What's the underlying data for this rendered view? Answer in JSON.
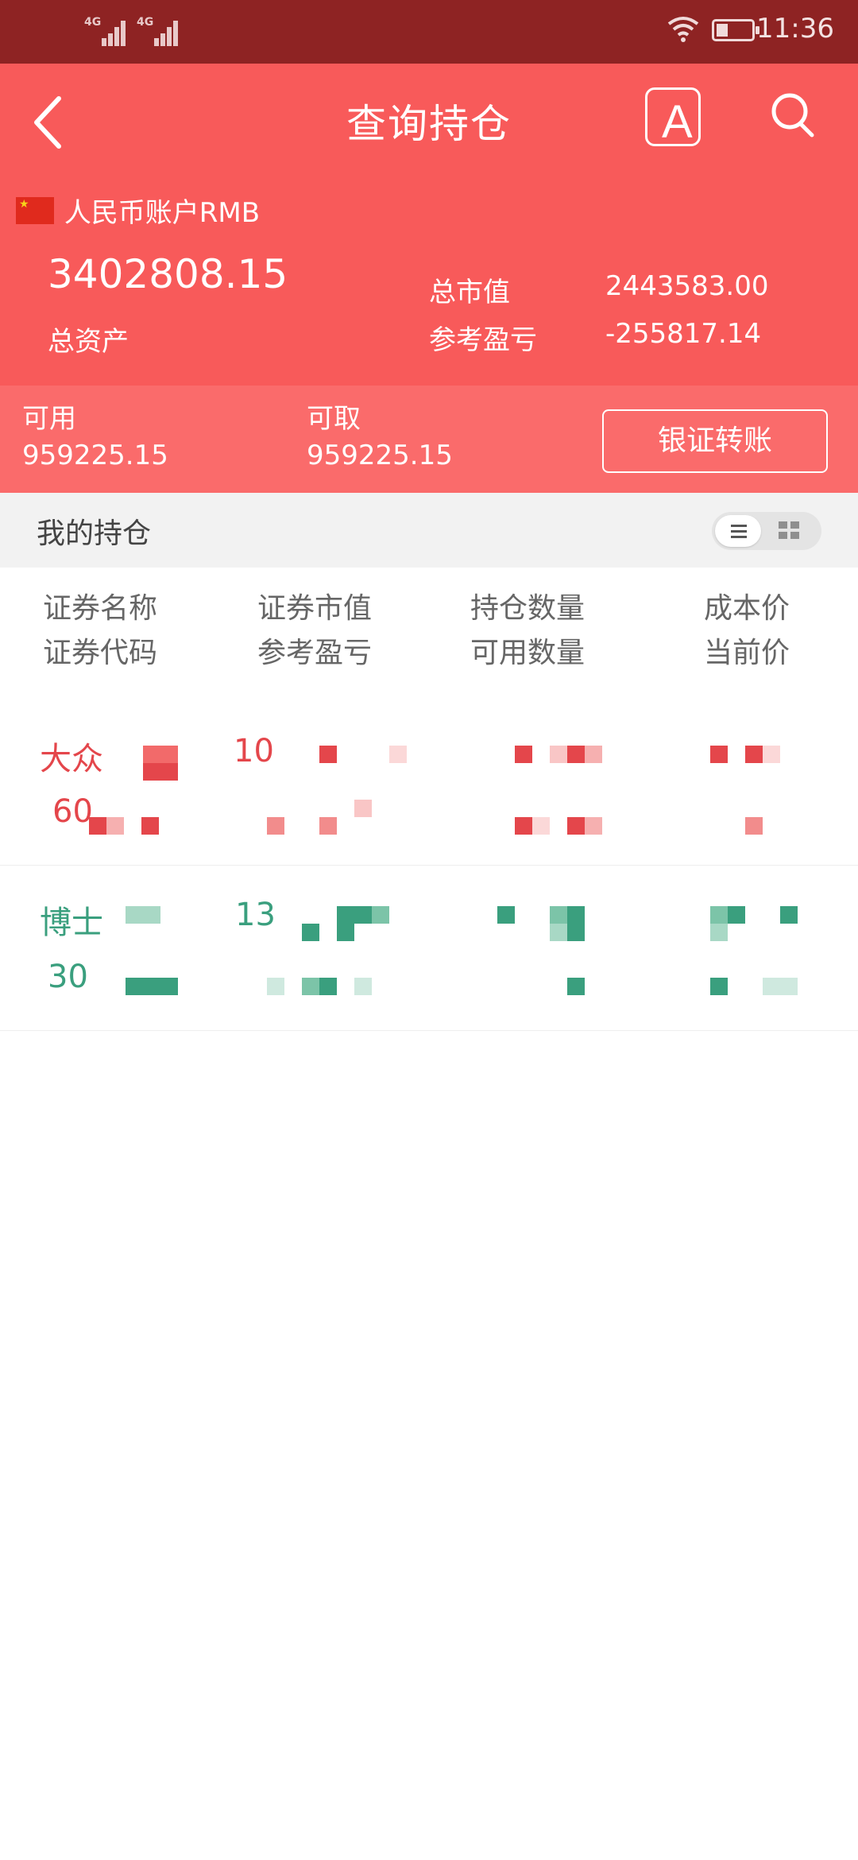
{
  "status_bar": {
    "network_1": "4G",
    "network_2": "4G",
    "time": "11:36"
  },
  "header": {
    "title": "查询持仓",
    "font_icon_label": "A",
    "account_label": "人民币账户RMB",
    "total_assets": "3402808.15",
    "total_assets_label": "总资产",
    "market_value_label": "总市值",
    "market_value": "2443583.00",
    "pnl_label": "参考盈亏",
    "pnl": "-255817.14"
  },
  "funds": {
    "available_label": "可用",
    "available": "959225.15",
    "withdrawable_label": "可取",
    "withdrawable": "959225.15",
    "transfer_button": "银证转账"
  },
  "positions": {
    "section_title": "我的持仓",
    "columns": [
      {
        "line1": "证券名称",
        "line2": "证券代码"
      },
      {
        "line1": "证券市值",
        "line2": "参考盈亏"
      },
      {
        "line1": "持仓数量",
        "line2": "可用数量"
      },
      {
        "line1": "成本价",
        "line2": "当前价"
      }
    ],
    "rows": [
      {
        "name": "大众",
        "code": "60",
        "market_value": "10",
        "pnl": "",
        "status": "gain"
      },
      {
        "name": "博士",
        "code": "30",
        "market_value": "13",
        "pnl": "",
        "status": "loss"
      }
    ]
  },
  "colors": {
    "status_bar": "#8e2323",
    "header": "#f85a5a",
    "funds_bar": "#fa6b6b",
    "gain_red": "#e4464b",
    "loss_green": "#3a9f7e"
  }
}
